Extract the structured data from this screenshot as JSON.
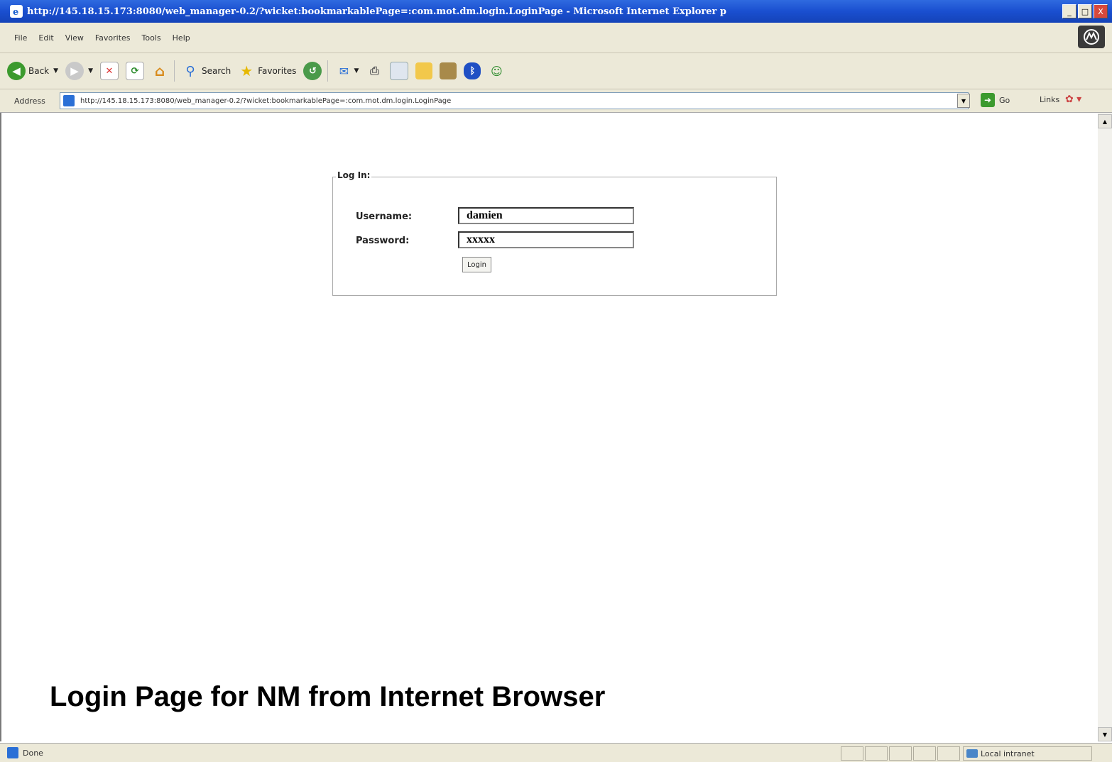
{
  "window": {
    "title": "http://145.18.15.173:8080/web_manager-0.2/?wicket:bookmarkablePage=:com.mot.dm.login.LoginPage - Microsoft Internet Explorer p",
    "minimize": "_",
    "maximize": "□",
    "close": "X"
  },
  "menu": [
    "File",
    "Edit",
    "View",
    "Favorites",
    "Tools",
    "Help"
  ],
  "toolbar": {
    "back_label": "Back",
    "search_label": "Search",
    "favorites_label": "Favorites"
  },
  "address": {
    "label": "Address",
    "url": "http://145.18.15.173:8080/web_manager-0.2/?wicket:bookmarkablePage=:com.mot.dm.login.LoginPage",
    "go_label": "Go",
    "links_label": "Links"
  },
  "login": {
    "legend": "Log In:",
    "username_label": "Username:",
    "username_value": "damien",
    "password_label": "Password:",
    "password_value": "xxxxx",
    "button_label": "Login"
  },
  "caption": "Login Page for NM from Internet Browser",
  "status": {
    "text": "Done",
    "zone": "Local intranet"
  }
}
